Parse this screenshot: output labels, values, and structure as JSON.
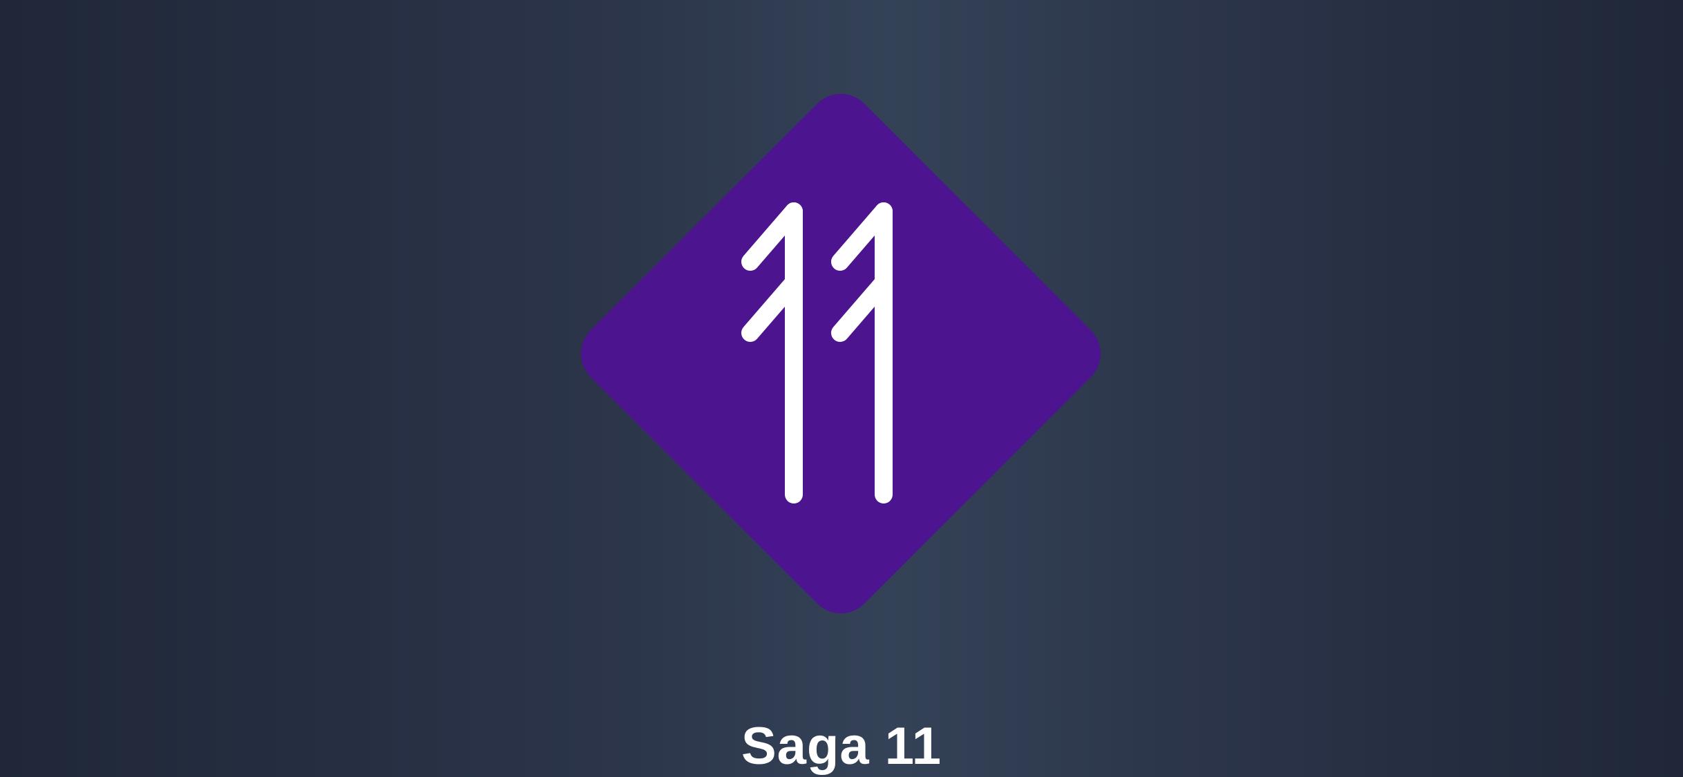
{
  "title": "Saga 11",
  "logo": {
    "icon": "saga-11-rune-logo-icon",
    "badge_color": "#4c148f",
    "glyph_color": "#ffffff"
  },
  "background": {
    "edge_color": "#1f2738",
    "center_color": "#344257"
  }
}
